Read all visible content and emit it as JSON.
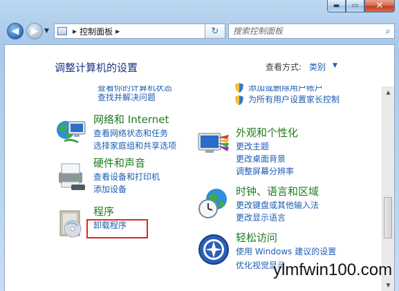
{
  "window": {
    "caption_buttons": {
      "minimize": "▬",
      "maximize": "▭",
      "close": "✕"
    }
  },
  "nav": {
    "breadcrumb": "控制面板",
    "search_placeholder": "搜索控制面板"
  },
  "header": {
    "title": "调整计算机的设置",
    "view_by_label": "查看方式:",
    "view_by_value": "类别"
  },
  "partial": {
    "left_top_clipped": "查看你的计算机状态",
    "left_top_link": "查找并解决问题",
    "right_top_clipped": "添加或删除用户帐户",
    "right_parental": "为所有用户设置家长控制"
  },
  "categories": {
    "network": {
      "title": "网络和 Internet",
      "links": [
        "查看网络状态和任务",
        "选择家庭组和共享选项"
      ]
    },
    "hardware": {
      "title": "硬件和声音",
      "links": [
        "查看设备和打印机",
        "添加设备"
      ]
    },
    "programs": {
      "title": "程序",
      "links": [
        "卸载程序"
      ]
    },
    "appearance": {
      "title": "外观和个性化",
      "links": [
        "更改主题",
        "更改桌面背景",
        "调整屏幕分辨率"
      ]
    },
    "clock": {
      "title": "时钟、语言和区域",
      "links": [
        "更改键盘或其他输入法",
        "更改显示语言"
      ]
    },
    "ease": {
      "title": "轻松访问",
      "links": [
        "使用 Windows 建议的设置",
        "优化视觉显示"
      ]
    }
  },
  "watermark": "ylmfwin100.com"
}
